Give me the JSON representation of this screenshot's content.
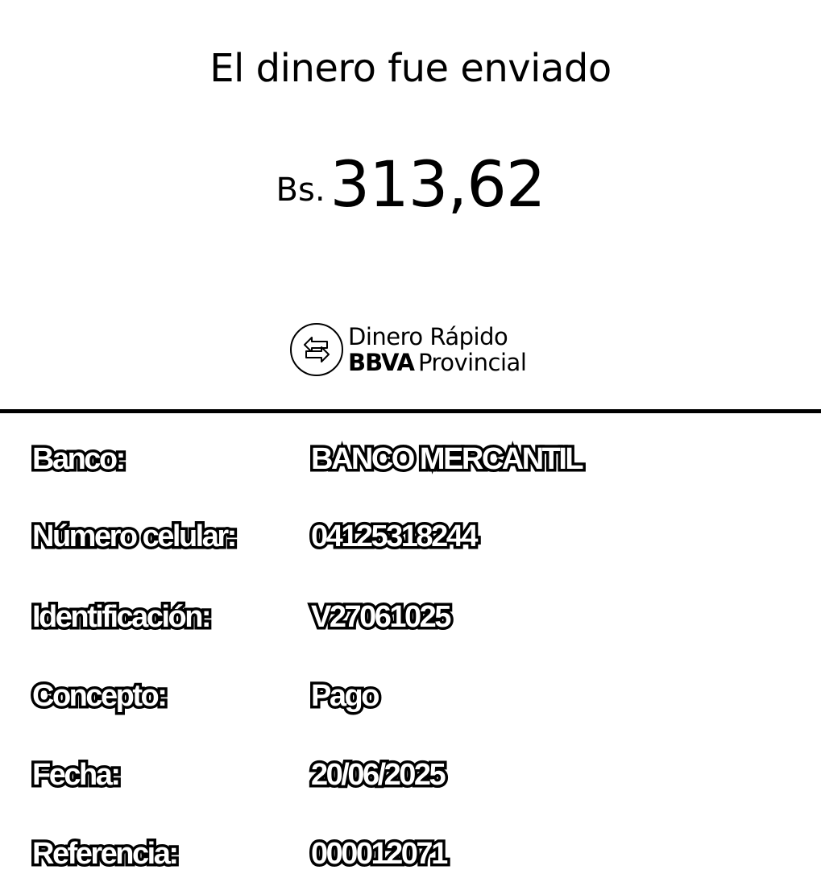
{
  "header": {
    "title": "El dinero fue enviado"
  },
  "amount": {
    "currency": "Bs.",
    "value": "313,62"
  },
  "brand": {
    "icon": "transfer-arrows-icon",
    "line1": "Dinero Rápido",
    "bank_name": "BBVA",
    "bank_suffix": "Provincial"
  },
  "details": [
    {
      "label": "Banco:",
      "value": "BANCO MERCANTIL"
    },
    {
      "label": "Número celular:",
      "value": "04125318244"
    },
    {
      "label": "Identificación:",
      "value": "V27061025"
    },
    {
      "label": "Concepto:",
      "value": "Pago"
    },
    {
      "label": "Fecha:",
      "value": "20/06/2025"
    },
    {
      "label": "Referencia:",
      "value": "000012071"
    }
  ],
  "colors": {
    "text": "#000000",
    "background": "#ffffff",
    "outline_fill": "#ffffff"
  }
}
